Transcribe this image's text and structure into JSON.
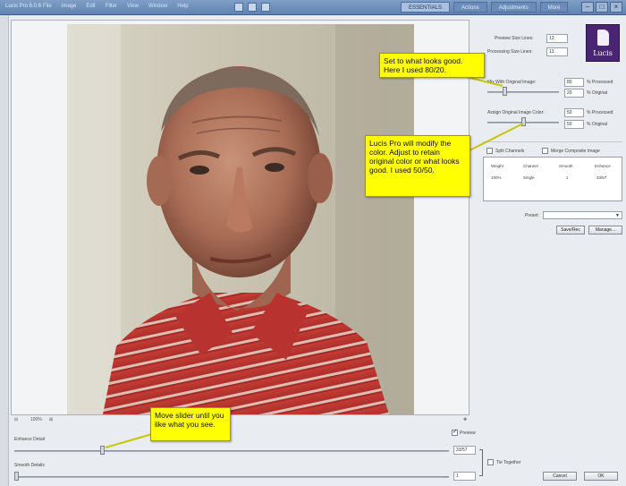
{
  "titlebar": {
    "title": "Lucis Pro 6.0.6",
    "menu": [
      "File",
      "Image",
      "Edit",
      "Filter",
      "View",
      "Window",
      "Help"
    ],
    "tabs": [
      "ESSENTIALS",
      "Actions",
      "Adjustments",
      "More"
    ]
  },
  "right": {
    "preview_size_label": "Preview Size Lines:",
    "preview_size_value": "13",
    "processing_size_label": "Processing Size Lines:",
    "processing_size_value": "13",
    "mix_label": "Mix With Original Image:",
    "mix_processed": "80",
    "mix_original": "20",
    "processed_unit": "% Processed",
    "original_unit": "% Original",
    "assign_label": "Assign Original Image Color:",
    "assign_processed": "50",
    "assign_original": "50",
    "split_channels_label": "Split Channels",
    "merge_label": "Merge Composite Image",
    "table_headers": [
      "Weight",
      "Channel",
      "Smooth",
      "Enhance"
    ],
    "table_row": [
      "100%",
      "Single",
      "1",
      "33/57"
    ],
    "preset_label": "Preset:",
    "save_label": "Save/Rec",
    "manage_label": "Manage...",
    "logo_text": "Lucis"
  },
  "bottom": {
    "zoom_label": "100%",
    "preview_label": "Preview",
    "enhance_label": "Enhance Detail",
    "enhance_value": "33/57",
    "smooth_label": "Smooth Details",
    "smooth_value": "1",
    "tie_label": "Tie Together",
    "cancel_label": "Cancel",
    "ok_label": "OK"
  },
  "callouts": {
    "mix": "Set to what looks good.\nHere I used 80/20.",
    "color": "Lucis Pro will modify the color. Adjust to retain original color or what looks good. I used 50/50.",
    "slider": "Move slider until you like what you see."
  },
  "colors": {
    "callout": "#ffff00",
    "titlebar": "#6f90bd",
    "logo": "#4a2573"
  }
}
